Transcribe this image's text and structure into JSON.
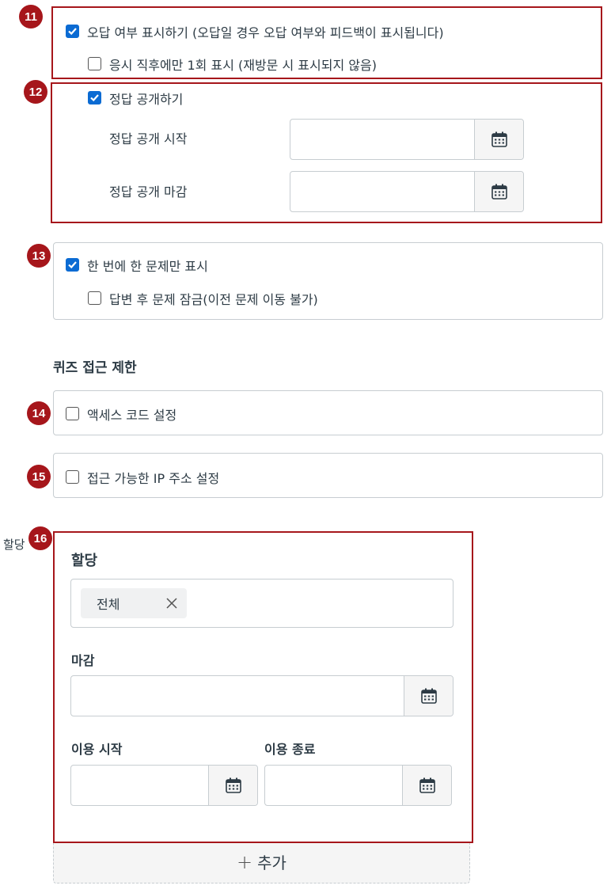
{
  "section11": {
    "badge": "11",
    "show_incorrect_label": "오답 여부 표시하기 (오답일 경우 오답 여부와 피드백이 표시됩니다)",
    "show_once_label": "응시 직후에만 1회 표시 (재방문 시 표시되지 않음)"
  },
  "section12": {
    "badge": "12",
    "reveal_answers_label": "정답 공개하기",
    "reveal_start_label": "정답 공개 시작",
    "reveal_end_label": "정답 공개 마감"
  },
  "section13": {
    "badge": "13",
    "one_question_label": "한 번에 한 문제만 표시",
    "lock_after_answer_label": "답변 후 문제 잠금(이전 문제 이동 불가)"
  },
  "restrict": {
    "heading": "퀴즈 접근 제한"
  },
  "section14": {
    "badge": "14",
    "access_code_label": "액세스 코드 설정"
  },
  "section15": {
    "badge": "15",
    "ip_label": "접근 가능한 IP 주소 설정"
  },
  "assign": {
    "side_label": "할당",
    "badge": "16",
    "heading": "할당",
    "tag_label": "전체",
    "due_label": "마감",
    "available_from_label": "이용 시작",
    "available_until_label": "이용 종료",
    "add_label": "추가",
    "add_glyph": "+"
  },
  "icons": {
    "calendar": "calendar-icon",
    "close": "close-icon",
    "check": "check-icon"
  },
  "colors": {
    "highlight_red": "#a6161b",
    "checkbox_blue": "#0b6bd3"
  }
}
